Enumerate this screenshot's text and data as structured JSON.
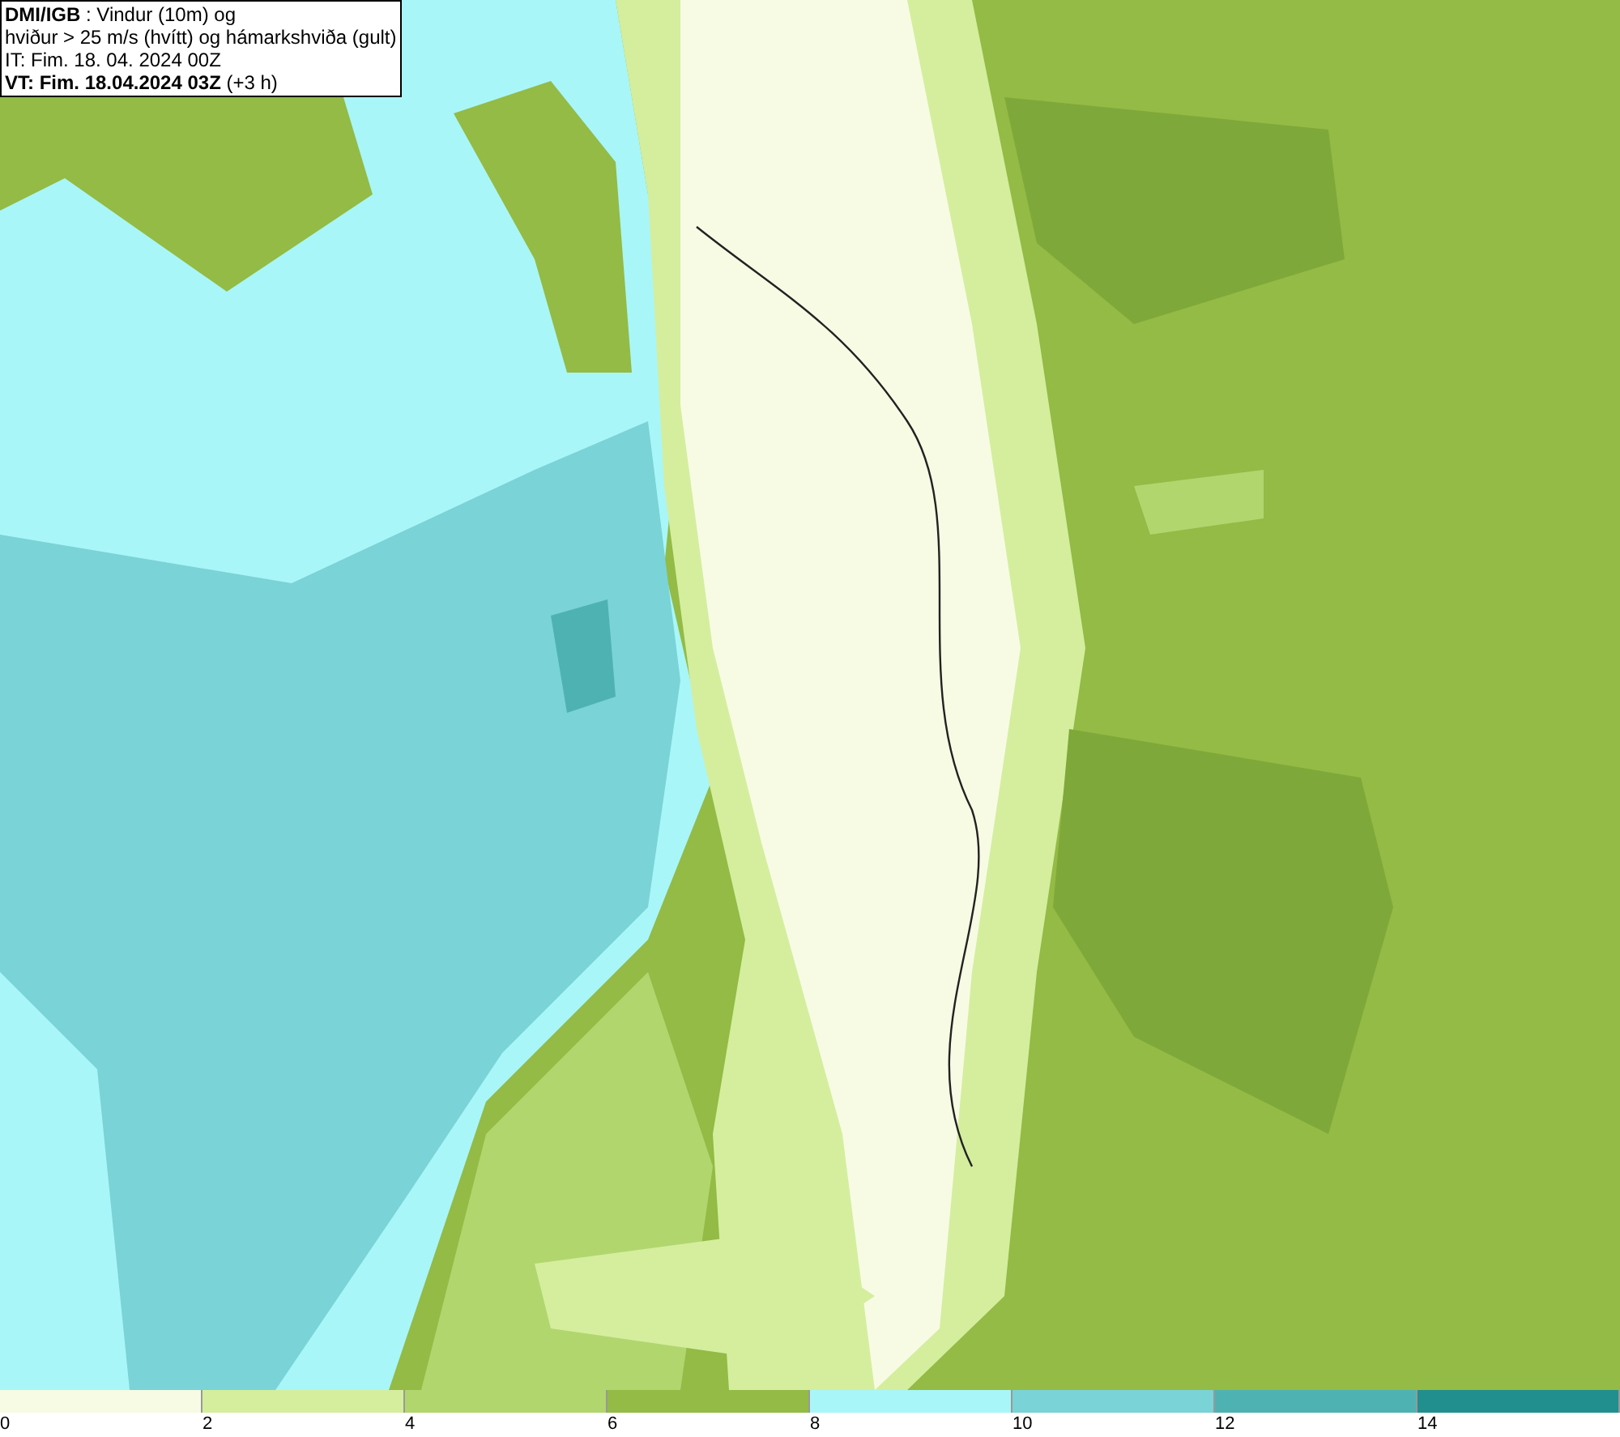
{
  "info_box": {
    "lines": [
      "**DMI/IGB** : Vindur (10m) og",
      "hviður > 25 m/s (hvítt) og hámarkshviða (gult)",
      "IT: Fim. 18. 04. 2024 00Z",
      "**VT: Fim. 18.04.2024 03Z** (+3 h)"
    ]
  },
  "legend": {
    "swatches": [
      {
        "color": "#f7fbe3"
      },
      {
        "color": "#d4ee9e"
      },
      {
        "color": "#b1d66e"
      },
      {
        "color": "#93bb45"
      },
      {
        "color": "#a9f6f8"
      },
      {
        "color": "#7ad3d6"
      },
      {
        "color": "#4fb2b2"
      },
      {
        "color": "#218f8e"
      }
    ],
    "ticks": [
      "0",
      "2",
      "4",
      "6",
      "8",
      "10",
      "12",
      "14"
    ]
  }
}
